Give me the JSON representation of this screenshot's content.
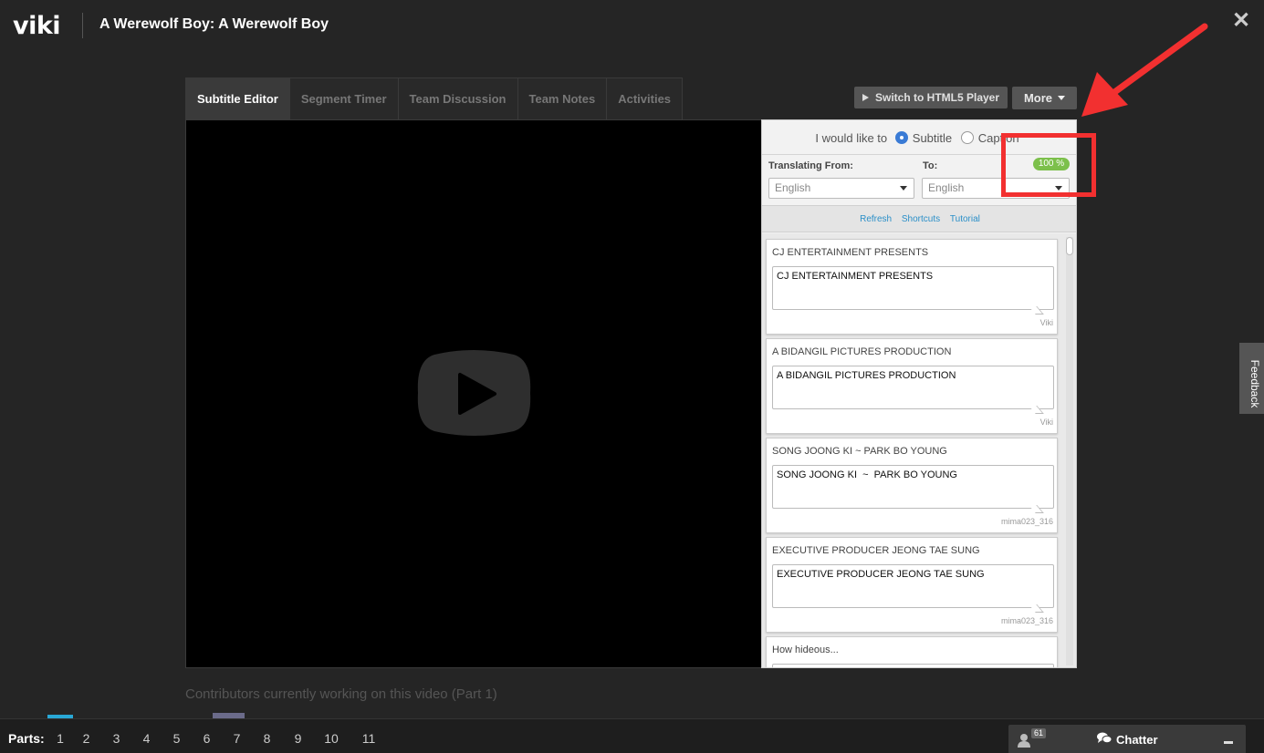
{
  "header": {
    "logo": "viki",
    "title": "A Werewolf Boy: A Werewolf Boy",
    "close_symbol": "✕"
  },
  "tabs": [
    {
      "label": "Subtitle Editor",
      "active": true
    },
    {
      "label": "Segment Timer",
      "active": false
    },
    {
      "label": "Team Discussion",
      "active": false
    },
    {
      "label": "Team Notes",
      "active": false
    },
    {
      "label": "Activities",
      "active": false
    }
  ],
  "toolbar": {
    "html5_label": "Switch to HTML5 Player",
    "more_label": "More"
  },
  "panel": {
    "mode_prompt": "I would like to",
    "mode_options": [
      "Subtitle",
      "Caption"
    ],
    "mode_selected": "Subtitle",
    "from_label": "Translating From:",
    "to_label": "To:",
    "from_value": "English",
    "to_value": "English",
    "progress": "100 %",
    "links": [
      "Refresh",
      "Shortcuts",
      "Tutorial"
    ]
  },
  "subtitles": [
    {
      "source": "CJ ENTERTAINMENT PRESENTS",
      "text": "CJ ENTERTAINMENT PRESENTS",
      "author": "Viki"
    },
    {
      "source": "A BIDANGIL PICTURES PRODUCTION",
      "text": "A BIDANGIL PICTURES PRODUCTION",
      "author": "Viki"
    },
    {
      "source": "SONG JOONG KI ~ PARK BO YOUNG",
      "text": "SONG JOONG KI  ~  PARK BO YOUNG",
      "author": "mima023_316"
    },
    {
      "source": "EXECUTIVE PRODUCER JEONG TAE SUNG",
      "text": "EXECUTIVE PRODUCER JEONG TAE SUNG",
      "author": "mima023_316"
    },
    {
      "source": "How hideous...",
      "text": "",
      "author": ""
    }
  ],
  "feedback_label": "Feedback",
  "contributors_label": "Contributors currently working on this video (Part 1)",
  "parts": {
    "label": "Parts:",
    "items": [
      "1",
      "2",
      "3",
      "4",
      "5",
      "6",
      "7",
      "8",
      "9",
      "10",
      "11"
    ]
  },
  "chatter": {
    "label": "Chatter",
    "user_count": "61"
  },
  "colors": {
    "annotation": "#f23030",
    "progress_green": "#7cc04b",
    "link_blue": "#2a8fc8",
    "accent_cyan": "#29a8d6"
  },
  "icons": [
    "close-icon",
    "play-icon",
    "users-icon",
    "chat-icon",
    "caret-down-icon",
    "minimize-icon"
  ]
}
